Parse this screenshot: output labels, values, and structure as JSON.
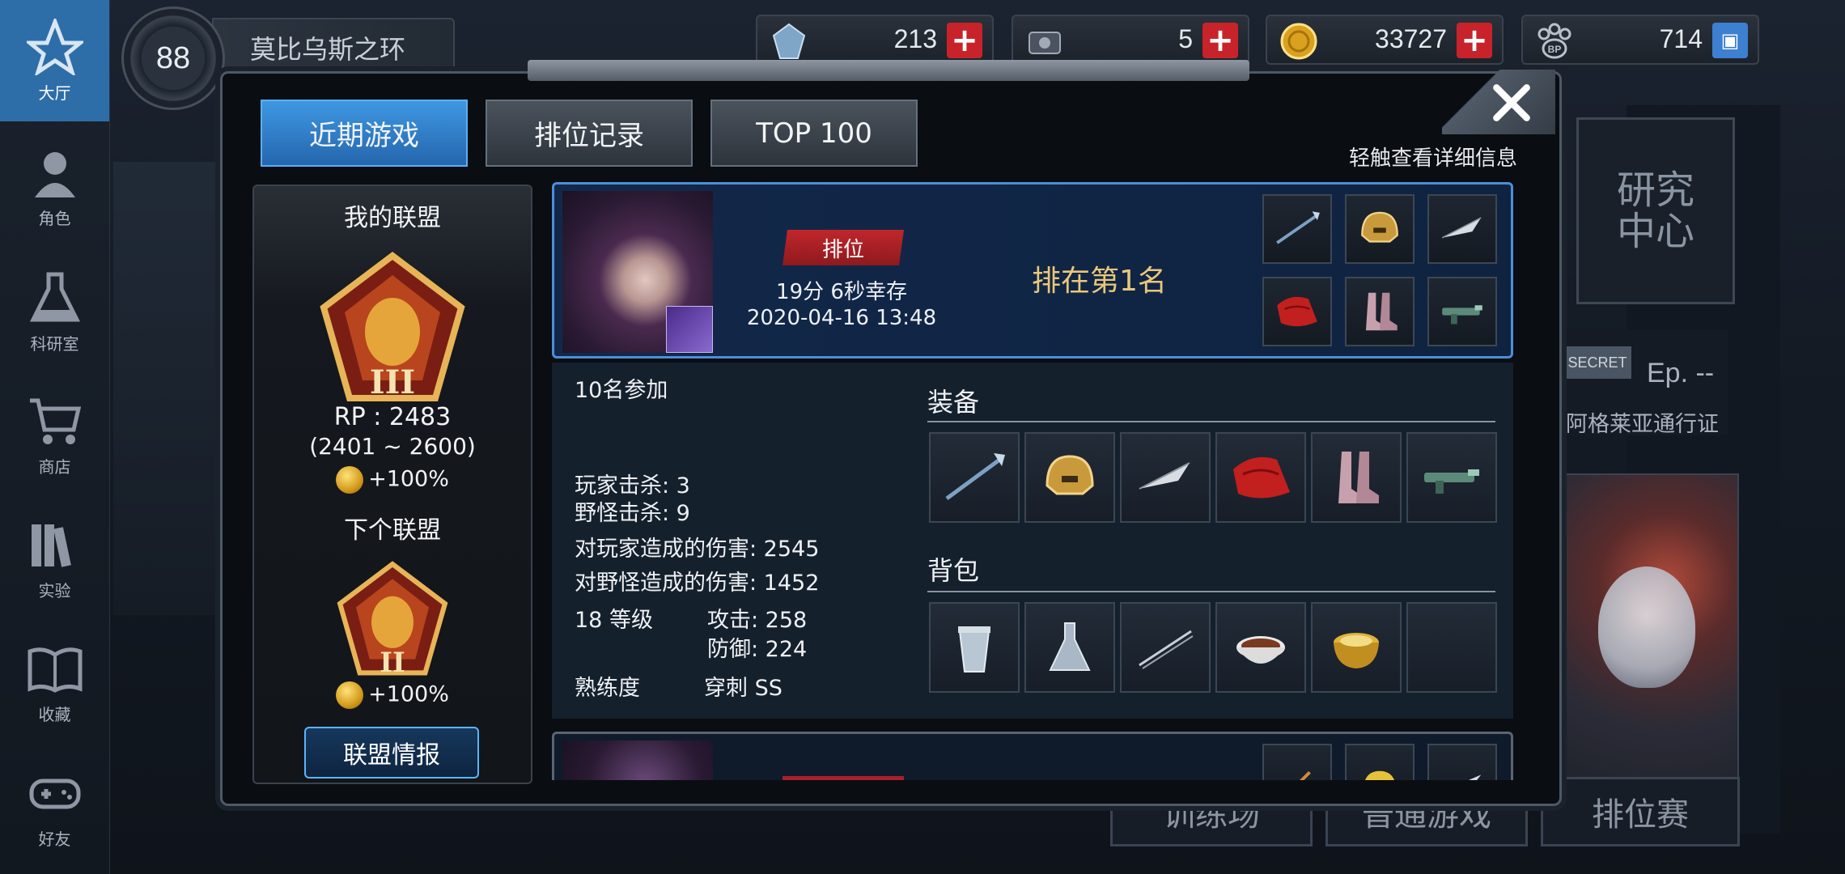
{
  "sidebar": {
    "items": [
      {
        "label": "大厅",
        "icon": "lobby-star-icon",
        "active": true
      },
      {
        "label": "角色",
        "icon": "character-icon"
      },
      {
        "label": "科研室",
        "icon": "flask-icon"
      },
      {
        "label": "商店",
        "icon": "cart-icon"
      },
      {
        "label": "实验",
        "icon": "books-icon"
      },
      {
        "label": "收藏",
        "icon": "open-book-icon"
      },
      {
        "label": "好友",
        "icon": "gamepad-icon"
      }
    ]
  },
  "topbar": {
    "level": "88",
    "map_name": "莫比乌斯之环",
    "resources": [
      {
        "name": "crystal",
        "value": "213",
        "icon": "crystal-icon"
      },
      {
        "name": "device",
        "value": "5",
        "icon": "device-icon"
      },
      {
        "name": "coin",
        "value": "33727",
        "icon": "coin-icon"
      },
      {
        "name": "bp",
        "value": "714",
        "icon": "bp-paw-icon"
      }
    ]
  },
  "background": {
    "research_center": "研究\n中心",
    "secret_label": "SECRET",
    "episode": "Ep. --",
    "pass_label": "阿格莱亚通行证",
    "bottom_buttons": [
      "训练场",
      "普通游戏",
      "排位赛"
    ]
  },
  "modal": {
    "tabs": [
      {
        "label": "近期游戏",
        "active": true
      },
      {
        "label": "排位记录",
        "active": false
      },
      {
        "label": "TOP 100",
        "active": false
      }
    ],
    "hint": "轻触查看详细信息",
    "league": {
      "my_title": "我的联盟",
      "my_tier": "III",
      "rp_text": "RP : 2483",
      "rp_range": "(2401 ~ 2600)",
      "my_bonus": "+100%",
      "next_title": "下个联盟",
      "next_tier": "II",
      "next_bonus": "+100%",
      "info_button": "联盟情报"
    },
    "record": {
      "mode_tag": "排位",
      "survival": "19分 6秒幸存",
      "datetime": "2020-04-16 13:48",
      "placement": "排在第1名",
      "mini_items": [
        "spear-icon",
        "helmet-icon",
        "feather-arrow-icon",
        "red-cloak-icon",
        "boots-icon",
        "jade-gun-icon"
      ]
    },
    "detail": {
      "participants": "10名参加",
      "player_kills": "玩家击杀: 3",
      "monster_kills": "野怪击杀: 9",
      "player_damage": "对玩家造成的伤害: 2545",
      "monster_damage": "对野怪造成的伤害: 1452",
      "level": "18 等级",
      "attack": "攻击: 258",
      "defense": "防御: 224",
      "mastery_label": "熟练度",
      "mastery_value": "穿刺 SS",
      "equipment_title": "装备",
      "equipment": [
        "spear-icon",
        "helmet-icon",
        "feather-arrow-icon",
        "red-cloak-icon",
        "boots-icon",
        "jade-gun-icon"
      ],
      "bag_title": "背包",
      "bag": [
        "cup-icon",
        "flask-icon",
        "needle-icon",
        "stew-bowl-icon",
        "golden-pot-icon",
        "empty-slot"
      ]
    }
  },
  "colors": {
    "accent_blue": "#2f7fcf",
    "rank_red": "#c0262b",
    "placement_gold": "#e9c77b"
  }
}
